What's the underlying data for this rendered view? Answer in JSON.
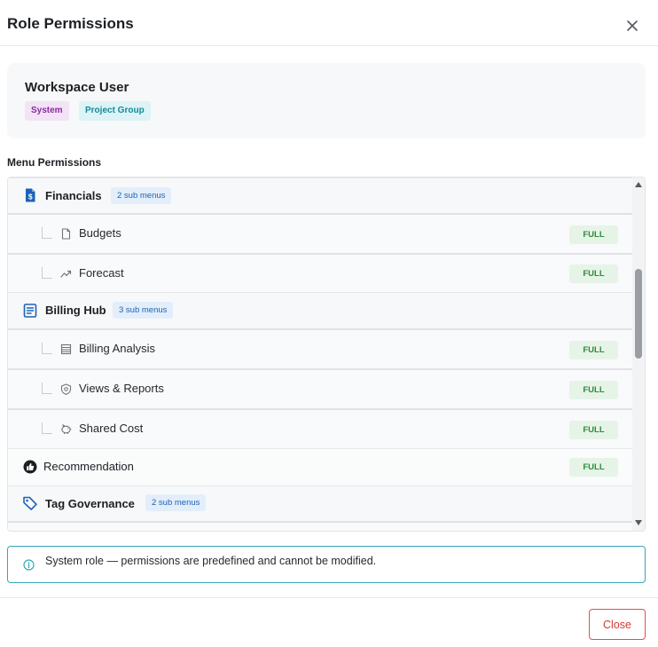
{
  "dialog": {
    "title": "Role Permissions",
    "close_icon": "close-icon"
  },
  "role": {
    "name": "Workspace User",
    "tags": [
      "System",
      "Project Group"
    ]
  },
  "permissions": {
    "section_label": "Menu Permissions",
    "items": [
      {
        "label": "Financials",
        "icon": "dollar-document-icon",
        "sub_count": "2 sub menus",
        "children": [
          {
            "label": "Budgets",
            "icon": "document-icon",
            "access": "FULL"
          },
          {
            "label": "Forecast",
            "icon": "trend-up-icon",
            "access": "FULL"
          }
        ]
      },
      {
        "label": "Billing Hub",
        "icon": "list-document-icon",
        "sub_count": "3 sub menus",
        "children": [
          {
            "label": "Billing Analysis",
            "icon": "table-icon",
            "access": "FULL"
          },
          {
            "label": "Views & Reports",
            "icon": "shield-icon",
            "access": "FULL"
          },
          {
            "label": "Shared Cost",
            "icon": "piggy-bank-icon",
            "access": "FULL"
          }
        ]
      },
      {
        "label": "Recommendation",
        "icon": "thumbs-up-icon",
        "access": "FULL"
      },
      {
        "label": "Tag Governance",
        "icon": "tag-icon",
        "sub_count": "2 sub menus"
      }
    ]
  },
  "notice": {
    "icon": "info-icon",
    "text": "System role — permissions are predefined and cannot be modified."
  },
  "footer": {
    "close_label": "Close"
  },
  "colors": {
    "accent_blue": "#1b63b8",
    "full_green": "#2f8a3a",
    "notice_border": "#36a7b4",
    "close_red": "#d23a34"
  }
}
